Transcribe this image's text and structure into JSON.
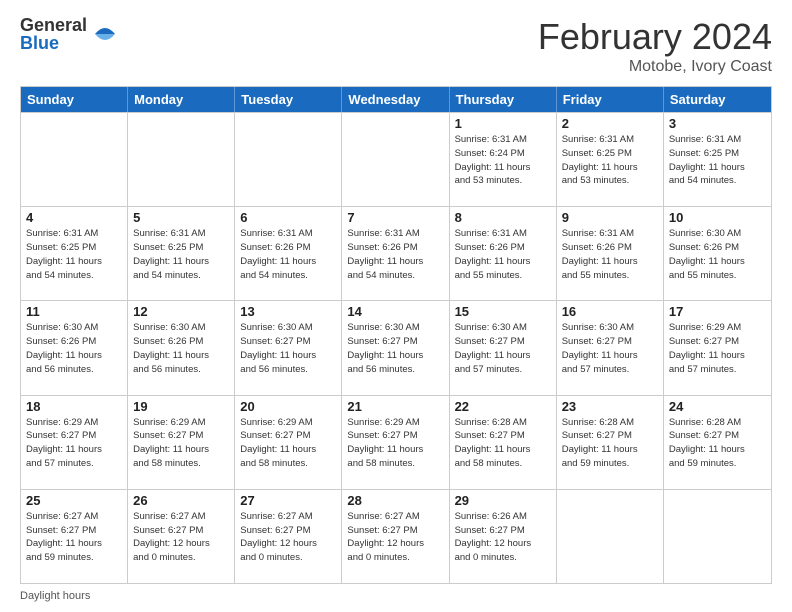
{
  "logo": {
    "general": "General",
    "blue": "Blue"
  },
  "title": "February 2024",
  "location": "Motobe, Ivory Coast",
  "days_of_week": [
    "Sunday",
    "Monday",
    "Tuesday",
    "Wednesday",
    "Thursday",
    "Friday",
    "Saturday"
  ],
  "footer_text": "Daylight hours",
  "weeks": [
    [
      {
        "day": "",
        "info": ""
      },
      {
        "day": "",
        "info": ""
      },
      {
        "day": "",
        "info": ""
      },
      {
        "day": "",
        "info": ""
      },
      {
        "day": "1",
        "info": "Sunrise: 6:31 AM\nSunset: 6:24 PM\nDaylight: 11 hours\nand 53 minutes."
      },
      {
        "day": "2",
        "info": "Sunrise: 6:31 AM\nSunset: 6:25 PM\nDaylight: 11 hours\nand 53 minutes."
      },
      {
        "day": "3",
        "info": "Sunrise: 6:31 AM\nSunset: 6:25 PM\nDaylight: 11 hours\nand 54 minutes."
      }
    ],
    [
      {
        "day": "4",
        "info": "Sunrise: 6:31 AM\nSunset: 6:25 PM\nDaylight: 11 hours\nand 54 minutes."
      },
      {
        "day": "5",
        "info": "Sunrise: 6:31 AM\nSunset: 6:25 PM\nDaylight: 11 hours\nand 54 minutes."
      },
      {
        "day": "6",
        "info": "Sunrise: 6:31 AM\nSunset: 6:26 PM\nDaylight: 11 hours\nand 54 minutes."
      },
      {
        "day": "7",
        "info": "Sunrise: 6:31 AM\nSunset: 6:26 PM\nDaylight: 11 hours\nand 54 minutes."
      },
      {
        "day": "8",
        "info": "Sunrise: 6:31 AM\nSunset: 6:26 PM\nDaylight: 11 hours\nand 55 minutes."
      },
      {
        "day": "9",
        "info": "Sunrise: 6:31 AM\nSunset: 6:26 PM\nDaylight: 11 hours\nand 55 minutes."
      },
      {
        "day": "10",
        "info": "Sunrise: 6:30 AM\nSunset: 6:26 PM\nDaylight: 11 hours\nand 55 minutes."
      }
    ],
    [
      {
        "day": "11",
        "info": "Sunrise: 6:30 AM\nSunset: 6:26 PM\nDaylight: 11 hours\nand 56 minutes."
      },
      {
        "day": "12",
        "info": "Sunrise: 6:30 AM\nSunset: 6:26 PM\nDaylight: 11 hours\nand 56 minutes."
      },
      {
        "day": "13",
        "info": "Sunrise: 6:30 AM\nSunset: 6:27 PM\nDaylight: 11 hours\nand 56 minutes."
      },
      {
        "day": "14",
        "info": "Sunrise: 6:30 AM\nSunset: 6:27 PM\nDaylight: 11 hours\nand 56 minutes."
      },
      {
        "day": "15",
        "info": "Sunrise: 6:30 AM\nSunset: 6:27 PM\nDaylight: 11 hours\nand 57 minutes."
      },
      {
        "day": "16",
        "info": "Sunrise: 6:30 AM\nSunset: 6:27 PM\nDaylight: 11 hours\nand 57 minutes."
      },
      {
        "day": "17",
        "info": "Sunrise: 6:29 AM\nSunset: 6:27 PM\nDaylight: 11 hours\nand 57 minutes."
      }
    ],
    [
      {
        "day": "18",
        "info": "Sunrise: 6:29 AM\nSunset: 6:27 PM\nDaylight: 11 hours\nand 57 minutes."
      },
      {
        "day": "19",
        "info": "Sunrise: 6:29 AM\nSunset: 6:27 PM\nDaylight: 11 hours\nand 58 minutes."
      },
      {
        "day": "20",
        "info": "Sunrise: 6:29 AM\nSunset: 6:27 PM\nDaylight: 11 hours\nand 58 minutes."
      },
      {
        "day": "21",
        "info": "Sunrise: 6:29 AM\nSunset: 6:27 PM\nDaylight: 11 hours\nand 58 minutes."
      },
      {
        "day": "22",
        "info": "Sunrise: 6:28 AM\nSunset: 6:27 PM\nDaylight: 11 hours\nand 58 minutes."
      },
      {
        "day": "23",
        "info": "Sunrise: 6:28 AM\nSunset: 6:27 PM\nDaylight: 11 hours\nand 59 minutes."
      },
      {
        "day": "24",
        "info": "Sunrise: 6:28 AM\nSunset: 6:27 PM\nDaylight: 11 hours\nand 59 minutes."
      }
    ],
    [
      {
        "day": "25",
        "info": "Sunrise: 6:27 AM\nSunset: 6:27 PM\nDaylight: 11 hours\nand 59 minutes."
      },
      {
        "day": "26",
        "info": "Sunrise: 6:27 AM\nSunset: 6:27 PM\nDaylight: 12 hours\nand 0 minutes."
      },
      {
        "day": "27",
        "info": "Sunrise: 6:27 AM\nSunset: 6:27 PM\nDaylight: 12 hours\nand 0 minutes."
      },
      {
        "day": "28",
        "info": "Sunrise: 6:27 AM\nSunset: 6:27 PM\nDaylight: 12 hours\nand 0 minutes."
      },
      {
        "day": "29",
        "info": "Sunrise: 6:26 AM\nSunset: 6:27 PM\nDaylight: 12 hours\nand 0 minutes."
      },
      {
        "day": "",
        "info": ""
      },
      {
        "day": "",
        "info": ""
      }
    ]
  ]
}
